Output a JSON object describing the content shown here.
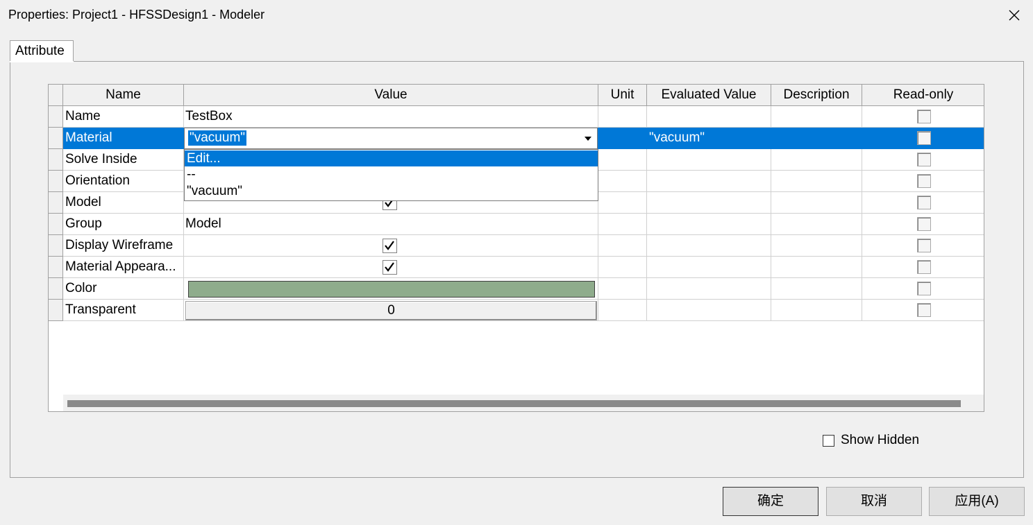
{
  "window": {
    "title": "Properties: Project1 - HFSSDesign1 - Modeler"
  },
  "tabs": [
    {
      "label": "Attribute"
    }
  ],
  "grid": {
    "columns": [
      "Name",
      "Value",
      "Unit",
      "Evaluated Value",
      "Description",
      "Read-only"
    ],
    "rows": [
      {
        "name": "Name",
        "value": "TestBox",
        "evaluated": ""
      },
      {
        "name": "Material",
        "value": "\"vacuum\"",
        "evaluated": "\"vacuum\""
      },
      {
        "name": "Solve Inside",
        "value": "",
        "evaluated": ""
      },
      {
        "name": "Orientation",
        "value": "",
        "evaluated": ""
      },
      {
        "name": "Model",
        "value": "",
        "checked": true
      },
      {
        "name": "Group",
        "value": "Model"
      },
      {
        "name": "Display Wireframe",
        "value": "",
        "checked": true
      },
      {
        "name": "Material Appeara...",
        "value": "",
        "checked": true
      },
      {
        "name": "Color",
        "value": "",
        "color": "#8fac8c"
      },
      {
        "name": "Transparent",
        "value": "0"
      }
    ],
    "selected_row": "Material"
  },
  "material_dropdown": {
    "current": "\"vacuum\"",
    "options": [
      "Edit...",
      "--",
      "\"vacuum\""
    ],
    "highlighted": "Edit..."
  },
  "show_hidden": {
    "label": "Show Hidden",
    "checked": false
  },
  "buttons": {
    "ok": "确定",
    "cancel": "取消",
    "apply": "应用(A)"
  },
  "colors": {
    "selection": "#0078d7",
    "object_color": "#8fac8c"
  }
}
